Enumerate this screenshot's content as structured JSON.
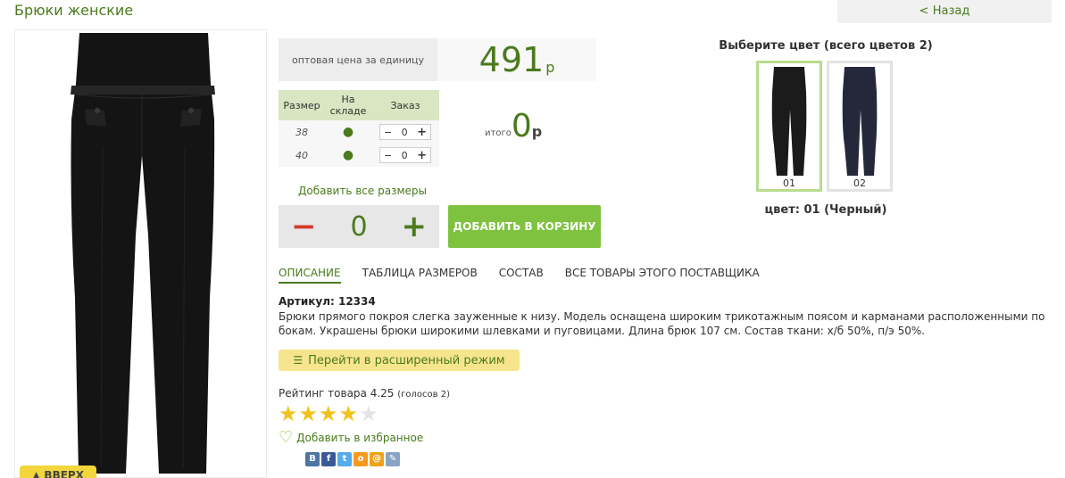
{
  "product": {
    "title": "Брюки женские",
    "back_label": "< Назад",
    "up_label": "▲ ВВЕРХ"
  },
  "price": {
    "label": "оптовая цена за единицу",
    "value": "491",
    "currency": "р"
  },
  "sizes": {
    "headers": [
      "Размер",
      "На складе",
      "Заказ"
    ],
    "rows": [
      {
        "size": "38",
        "stock": "●",
        "qty": "0"
      },
      {
        "size": "40",
        "stock": "●",
        "qty": "0"
      }
    ],
    "minus": "−",
    "plus": "+"
  },
  "total": {
    "label": "итого",
    "value": "0",
    "currency": "р"
  },
  "add_all_sizes": "Добавить все размеры",
  "quantity": {
    "minus": "−",
    "value": "0",
    "plus": "+"
  },
  "cart_button": "ДОБАВИТЬ В КОРЗИНУ",
  "tabs": [
    {
      "label": "ОПИСАНИЕ",
      "active": true
    },
    {
      "label": "ТАБЛИЦА РАЗМЕРОВ",
      "active": false
    },
    {
      "label": "СОСТАВ",
      "active": false
    },
    {
      "label": "ВСЕ ТОВАРЫ ЭТОГО ПОСТАВЩИКА",
      "active": false
    }
  ],
  "article": "Артикул: 12334",
  "description": "Брюки прямого покроя слегка зауженные к низу. Модель оснащена широким трикотажным поясом и карманами расположенными по бокам. Украшены брюки широкими шлевками и пуговицами. Длина брюк 107 см. Состав ткани: х/б 50%, п/э 50%.",
  "extended_mode": {
    "icon": "list-icon",
    "label": "Перейти в расширенный режим"
  },
  "rating": {
    "label": "Рейтинг товара 4.25",
    "votes": "(голосов 2)",
    "value": 4.25,
    "max": 5
  },
  "favorite": {
    "icon": "heart-icon",
    "label": "Добавить в избранное"
  },
  "social": [
    {
      "name": "vk-icon",
      "glyph": "В",
      "color": "#4c75a3"
    },
    {
      "name": "facebook-icon",
      "glyph": "f",
      "color": "#3b5998"
    },
    {
      "name": "twitter-icon",
      "glyph": "t",
      "color": "#55acee"
    },
    {
      "name": "odnoklassniki-icon",
      "glyph": "о",
      "color": "#f59a1e"
    },
    {
      "name": "mailru-icon",
      "glyph": "@",
      "color": "#f0a21c"
    },
    {
      "name": "livejournal-icon",
      "glyph": "✎",
      "color": "#8aa3c4"
    }
  ],
  "colors": {
    "title": "Выберите цвет (всего цветов 2)",
    "options": [
      {
        "code": "01",
        "fill": "#1b1b1b",
        "selected": true
      },
      {
        "code": "02",
        "fill": "#24283a",
        "selected": false
      }
    ],
    "current": "цвет: 01 (Черный)"
  },
  "palette": {
    "accent": "#4a7a1c",
    "button_green": "#7fc240",
    "minus_red": "#d13b2e",
    "star": "#f2c21b"
  }
}
